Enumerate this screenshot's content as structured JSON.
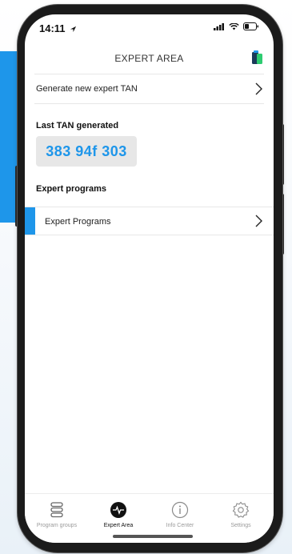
{
  "status": {
    "time": "14:11",
    "location_icon": "location-arrow-icon",
    "icons": [
      "signal-icon",
      "wifi-icon",
      "battery-icon"
    ]
  },
  "header": {
    "title": "EXPERT AREA",
    "right_icon": "device-status-icon"
  },
  "generate": {
    "label": "Generate new expert TAN"
  },
  "last_tan": {
    "label": "Last TAN generated",
    "value": "383 94f 303"
  },
  "expert_programs": {
    "section_label": "Expert programs",
    "item_label": "Expert Programs"
  },
  "tabs": [
    {
      "label": "Program groups",
      "icon": "stack-icon",
      "active": false
    },
    {
      "label": "Expert Area",
      "icon": "pulse-icon",
      "active": true
    },
    {
      "label": "Info Center",
      "icon": "info-icon",
      "active": false
    },
    {
      "label": "Settings",
      "icon": "gear-icon",
      "active": false
    }
  ],
  "colors": {
    "accent": "#1e96ea",
    "tan_box": "#e7e7e7"
  }
}
